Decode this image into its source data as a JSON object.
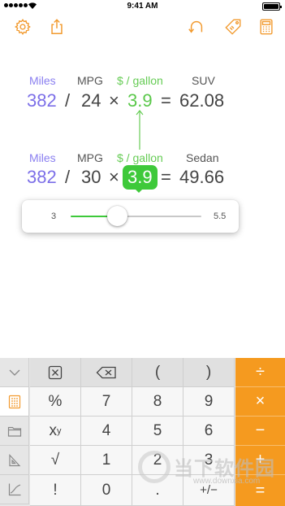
{
  "status_bar": {
    "time": "9:41 AM"
  },
  "toolbar": {
    "left": [
      {
        "icon": "settings-gear-icon"
      },
      {
        "icon": "share-icon"
      }
    ],
    "right": [
      {
        "icon": "undo-icon"
      },
      {
        "icon": "tag-icon"
      },
      {
        "icon": "calculator-icon"
      }
    ],
    "accent": "#f29a2e"
  },
  "equation_suv": {
    "labels": {
      "miles": "Miles",
      "mpg": "MPG",
      "price": "$ / gallon",
      "result": "SUV"
    },
    "values": {
      "miles": "382",
      "op1": "/",
      "mpg": "24",
      "op2": "×",
      "price": "3.9",
      "eq": "=",
      "result": "62.08"
    }
  },
  "equation_sedan": {
    "labels": {
      "miles": "Miles",
      "mpg": "MPG",
      "price": "$ / gallon",
      "result": "Sedan"
    },
    "values": {
      "miles": "382",
      "op1": "/",
      "mpg": "30",
      "op2": "×",
      "price": "3.9",
      "eq": "=",
      "result": "49.66"
    }
  },
  "slider": {
    "min": "3",
    "max": "5.5",
    "value": 3.9,
    "min_value": 3,
    "max_value": 5.5
  },
  "keypad": {
    "side_keys": [
      {
        "icon": "chevron-down-icon"
      },
      {
        "icon": "keypad-grid-icon",
        "active": true
      },
      {
        "icon": "folder-icon"
      },
      {
        "icon": "triangle-ruler-icon"
      },
      {
        "icon": "graph-icon"
      }
    ],
    "rows": [
      [
        "⊠",
        "⌫",
        "(",
        ")"
      ],
      [
        "%",
        "7",
        "8",
        "9"
      ],
      [
        "x",
        "4",
        "5",
        "6"
      ],
      [
        "√",
        "1",
        "2",
        "3"
      ],
      [
        "!",
        "0",
        ".",
        "+/−"
      ]
    ],
    "exponent_sup": "y",
    "operators": [
      "÷",
      "×",
      "−",
      "+",
      "="
    ],
    "operator_color": "#f59a1f"
  },
  "watermark": {
    "text": "当下软件园",
    "url": "www.downxia.com"
  }
}
